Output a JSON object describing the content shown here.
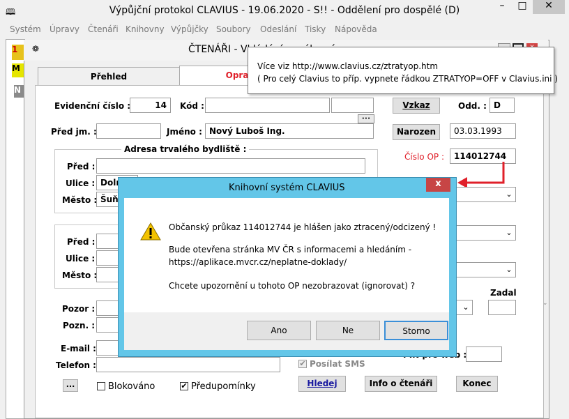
{
  "app": {
    "title": "Výpůjční protokol CLAVIUS - 19.06.2020 - S!! - Oddělení pro dospělé (D)",
    "minimize": "–",
    "maximize": "□",
    "close": "✕"
  },
  "menu": [
    "Systém",
    "Úpravy",
    "Čtenáři",
    "Knihovny",
    "Výpůjčky",
    "Soubory",
    "Odeslání",
    "Tisky",
    "Nápověda"
  ],
  "left_strip": {
    "top_text": "1",
    "second_text": "M",
    "third_text": "N"
  },
  "child": {
    "title": "ČTENÁŘI - Vkládání nového záznamu",
    "tabs": [
      "Přehled",
      "Oprava"
    ]
  },
  "form": {
    "evidencni_label": "Evidenční číslo :",
    "evidencni_value": "14",
    "kod_label": "Kód :",
    "kod_value": "",
    "ellipsis": "•••",
    "vzkaz_btn": "Vzkaz",
    "odd_label": "Odd. :",
    "odd_value": "D",
    "predjm_label": "Před jm. :",
    "predjm_value": "",
    "jmeno_label": "Jméno :",
    "jmeno_value": "Nový Luboš Ing.",
    "narozen_btn": "Narozen",
    "narozen_value": "03.03.1993",
    "adresa_legend": "Adresa trvalého bydliště :",
    "pred_label": "Před :",
    "ulice_label": "Ulice :",
    "ulice_value": "Doln",
    "mesto_label": "Město :",
    "mesto_value": "Šuň",
    "cislo_op_label": "Číslo OP :",
    "cislo_op_value": "114012744",
    "pred2_label": "Před :",
    "ulice2_label": "Ulice :",
    "mesto2_label": "Město :",
    "pozor_label": "Pozor :",
    "pozn_label": "Pozn. :",
    "zadal_label": "Zadal",
    "email_label": "E-mail :",
    "telefon_label": "Telefon :",
    "posilat_sms": "Posílat SMS",
    "pin_label": "PIN pro web :",
    "blokovano": "Blokováno",
    "predupominky": "Předupomínky",
    "hledej_btn": "Hledej",
    "info_btn": "Info o čtenáři",
    "konec_btn": "Konec",
    "small_btn": "..."
  },
  "tooltip": {
    "line1": "Více viz http://www.clavius.cz/ztratyop.htm",
    "line2": "( Pro celý Clavius to příp. vypnete řádkou ZTRATYOP=OFF v Clavius.ini )"
  },
  "dialog": {
    "title": "Knihovní systém CLAVIUS",
    "close": "x",
    "line1": "Občanský průkaz 114012744 je hlášen jako ztracený/odcizený !",
    "line2": "Bude otevřena stránka MV ČR s informacemi a hledáním -",
    "line3": "https://aplikace.mvcr.cz/neplatne-doklady/",
    "line4": "Chcete upozornění u tohoto OP nezobrazovat (ignorovat) ?",
    "btn_ano": "Ano",
    "btn_ne": "Ne",
    "btn_storno": "Storno"
  },
  "colors": {
    "accent_red": "#e0202a",
    "dialog_frame": "#63c6e8"
  }
}
